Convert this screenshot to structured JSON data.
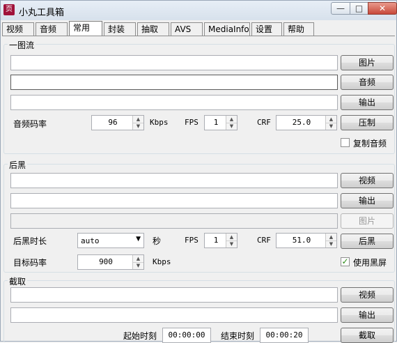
{
  "window": {
    "title": "小丸工具箱",
    "icon_glyph": "页",
    "controls": {
      "minimize": "—",
      "maximize": "□",
      "close": "✕"
    }
  },
  "tabs": [
    "视频",
    "音频",
    "常用",
    "封装",
    "抽取",
    "AVS",
    "MediaInfo",
    "设置",
    "帮助"
  ],
  "active_tab": "常用",
  "one_image": {
    "label": "一图流",
    "image_button": "图片",
    "audio_button": "音频",
    "output_button": "输出",
    "audio_bitrate_label": "音频码率",
    "audio_bitrate_value": "96",
    "kbps_unit": "Kbps",
    "fps_label": "FPS",
    "fps_value": "1",
    "crf_label": "CRF",
    "crf_value": "25.0",
    "compress_button": "压制",
    "copy_audio_label": "复制音频",
    "copy_audio_checked": false
  },
  "black_tail": {
    "label": "后黑",
    "video_button": "视频",
    "output_button": "输出",
    "image_button": "图片",
    "duration_label": "后黑时长",
    "duration_value": "auto",
    "seconds_unit": "秒",
    "fps_label": "FPS",
    "fps_value": "1",
    "crf_label": "CRF",
    "crf_value": "51.0",
    "run_button": "后黑",
    "target_bitrate_label": "目标码率",
    "target_bitrate_value": "900",
    "kbps_unit": "Kbps",
    "use_black_label": "使用黑屏",
    "use_black_checked": true
  },
  "clip": {
    "label": "截取",
    "video_button": "视频",
    "output_button": "输出",
    "start_label": "起始时刻",
    "start_value": "00:00:00",
    "end_label": "结束时刻",
    "end_value": "00:00:20",
    "clip_button": "截取"
  },
  "colors": {
    "check_green": "#2a8a16",
    "close_red": "#c8493a"
  }
}
